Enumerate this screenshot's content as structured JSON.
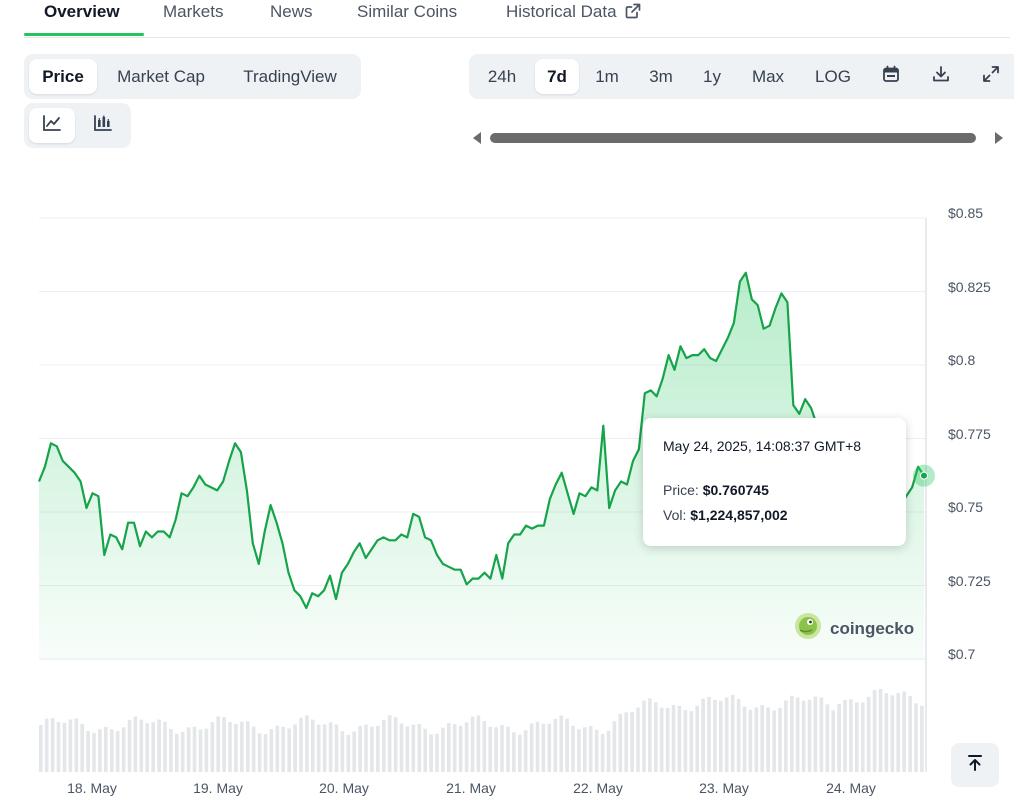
{
  "tabs": {
    "overview": "Overview",
    "markets": "Markets",
    "news": "News",
    "similar_coins": "Similar Coins",
    "historical_data": "Historical Data"
  },
  "chart_type_toggle": {
    "price": "Price",
    "market_cap": "Market Cap",
    "trading_view": "TradingView"
  },
  "view_icons": [
    "line-chart-icon",
    "candlestick-icon"
  ],
  "ranges": {
    "h24": "24h",
    "d7": "7d",
    "m1": "1m",
    "m3": "3m",
    "y1": "1y",
    "max": "Max",
    "log": "LOG",
    "selected": "7d"
  },
  "toolbar_icons": [
    "calendar-icon",
    "download-icon",
    "fullscreen-icon"
  ],
  "tooltip": {
    "date": "May 24, 2025, 14:08:37 GMT+8",
    "price_label": "Price:",
    "price_value": "$0.760745",
    "vol_label": "Vol:",
    "vol_value": "$1,224,857,002"
  },
  "watermark": "coingecko",
  "colors": {
    "accent": "#22c55e",
    "line": "#16a34a"
  },
  "chart_data": {
    "type": "line",
    "y_tick_labels": [
      "$0.85",
      "$0.825",
      "$0.8",
      "$0.775",
      "$0.75",
      "$0.725",
      "$0.7"
    ],
    "x_tick_labels": [
      "18. May",
      "19. May",
      "20. May",
      "21. May",
      "22. May",
      "23. May",
      "24. May"
    ],
    "ylim": [
      0.7,
      0.85
    ],
    "grid": true,
    "series": [
      {
        "values": [
          0.759,
          0.764,
          0.772,
          0.771,
          0.766,
          0.764,
          0.762,
          0.759,
          0.75,
          0.755,
          0.754,
          0.734,
          0.741,
          0.74,
          0.736,
          0.745,
          0.745,
          0.737,
          0.742,
          0.74,
          0.742,
          0.742,
          0.74,
          0.746,
          0.755,
          0.754,
          0.757,
          0.761,
          0.758,
          0.757,
          0.756,
          0.759,
          0.766,
          0.772,
          0.769,
          0.756,
          0.738,
          0.731,
          0.742,
          0.751,
          0.745,
          0.738,
          0.728,
          0.722,
          0.72,
          0.716,
          0.721,
          0.72,
          0.722,
          0.727,
          0.719,
          0.728,
          0.731,
          0.735,
          0.738,
          0.733,
          0.736,
          0.739,
          0.74,
          0.739,
          0.739,
          0.741,
          0.74,
          0.748,
          0.747,
          0.74,
          0.739,
          0.734,
          0.731,
          0.73,
          0.729,
          0.729,
          0.724,
          0.726,
          0.726,
          0.728,
          0.726,
          0.734,
          0.726,
          0.738,
          0.741,
          0.741,
          0.744,
          0.743,
          0.744,
          0.744,
          0.753,
          0.758,
          0.762,
          0.755,
          0.748,
          0.755,
          0.754,
          0.757,
          0.756,
          0.778,
          0.75,
          0.756,
          0.759,
          0.758,
          0.766,
          0.77,
          0.789,
          0.79,
          0.788,
          0.794,
          0.802,
          0.797,
          0.805,
          0.801,
          0.802,
          0.802,
          0.804,
          0.801,
          0.8,
          0.804,
          0.808,
          0.813,
          0.827,
          0.83,
          0.821,
          0.819,
          0.811,
          0.812,
          0.818,
          0.823,
          0.82,
          0.785,
          0.782,
          0.787,
          0.784,
          0.778,
          0.772,
          0.77,
          0.768,
          0.766,
          0.77,
          0.768,
          0.764,
          0.766,
          0.771,
          0.767,
          0.769,
          0.762,
          0.756,
          0.751,
          0.754,
          0.757,
          0.764,
          0.761
        ]
      }
    ],
    "volume_bars": true
  }
}
